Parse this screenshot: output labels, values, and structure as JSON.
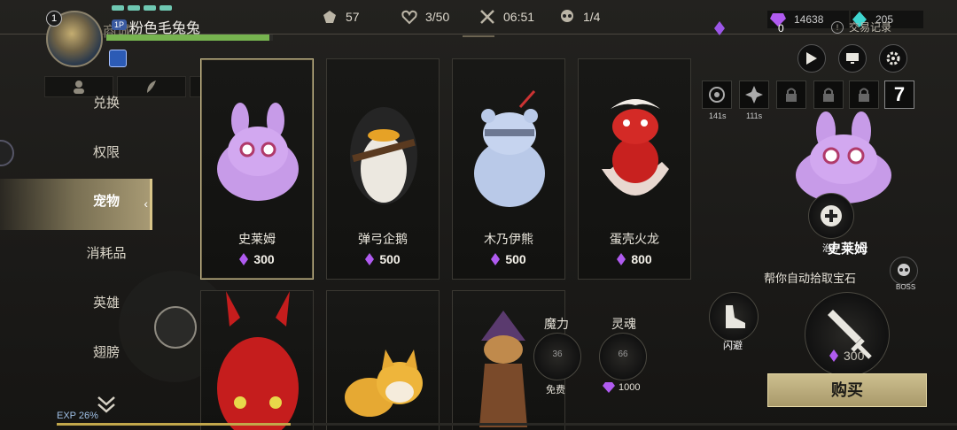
{
  "player": {
    "level": "1",
    "badge": "1P",
    "name": "粉色毛兔兔",
    "obscured_label": "商城",
    "hp_fraction": 0.98
  },
  "stats": {
    "power": "57",
    "health": "3/50",
    "timer": "06:51",
    "kills": "1/4"
  },
  "currency": {
    "gems": "14638",
    "crystals": "205",
    "purple_gems": "0",
    "trade_record": "交易记录"
  },
  "menu": {
    "items": [
      "兑换",
      "权限",
      "宠物",
      "消耗品",
      "英雄",
      "翅膀"
    ],
    "active": "宠物"
  },
  "cards": [
    {
      "name": "史莱姆",
      "price": "300"
    },
    {
      "name": "弹弓企鹅",
      "price": "500"
    },
    {
      "name": "木乃伊熊",
      "price": "500"
    },
    {
      "name": "蛋壳火龙",
      "price": "800"
    }
  ],
  "cooldowns": {
    "slot1": "141s",
    "slot2": "111s",
    "counter": "7"
  },
  "detail": {
    "name": "史莱姆",
    "heal_label": "治疗",
    "description": "帮你自动拾取宝石",
    "price": "300",
    "buy_label": "购买"
  },
  "skills": {
    "mana_label": "魔力",
    "mana_value": "36",
    "mana_cost": "免费",
    "soul_label": "灵魂",
    "soul_value": "66",
    "soul_cost": "1000",
    "dodge_label": "闪避",
    "attack_label": "攻击",
    "boss_label": "BOSS"
  },
  "exp": {
    "label": "EXP 26%",
    "fraction": 0.26
  },
  "colors": {
    "accent": "#c6b98a",
    "gem_purple": "#b05bf0",
    "hp_green": "#76b34f"
  }
}
